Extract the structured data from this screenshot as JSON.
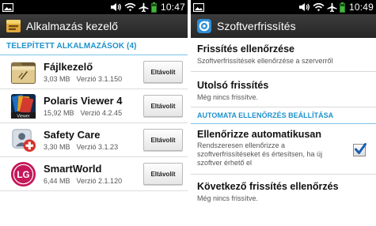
{
  "left": {
    "status_time": "10:47",
    "title": "Alkalmazás kezelő",
    "section_header": "TELEPÍTETT ALKALMAZÁSOK (4)",
    "apps": [
      {
        "name": "Fájlkezelő",
        "size": "3,03 MB",
        "version": "Verzió 3.1.150",
        "button": "Eltávolít"
      },
      {
        "name": "Polaris Viewer 4",
        "size": "15,92 MB",
        "version": "Verzió 4.2.45",
        "button": "Eltávolít"
      },
      {
        "name": "Safety Care",
        "size": "3,30 MB",
        "version": "Verzió 3.1.23",
        "button": "Eltávolít"
      },
      {
        "name": "SmartWorld",
        "size": "6,44 MB",
        "version": "Verzió 2.1.120",
        "button": "Eltávolít"
      }
    ],
    "icons": [
      "folder-icon",
      "polaris-viewer-icon",
      "safety-care-icon",
      "smartworld-lg-icon"
    ],
    "viewer_label": "Viewer",
    "lg_logo_text": "LG"
  },
  "right": {
    "status_time": "10:49",
    "title": "Szoftverfrissítés",
    "check_title": "Frissítés ellenőrzése",
    "check_sub": "Szoftverfrissítések ellenőrzése a szerverről",
    "last_title": "Utolsó frissítés",
    "last_sub": "Még nincs frissítve.",
    "section_header": "AUTOMATA ELLENŐRZÉS BEÁLLÍTÁSA",
    "auto_title": "Ellenőrizze automatikusan",
    "auto_sub": "Rendszeresen ellenőrizze a szoftverfrissítéseket és értesítsen, ha új szoftver érhető el",
    "auto_checked": true,
    "next_title": "Következő frissítés ellenőrzés",
    "next_sub": "Még nincs frissítve."
  },
  "colors": {
    "accent": "#1e92cc",
    "titlebar": "#2f2f2f",
    "statusbar": "#000000",
    "battery": "#40b93c",
    "check": "#1a5fb4"
  }
}
